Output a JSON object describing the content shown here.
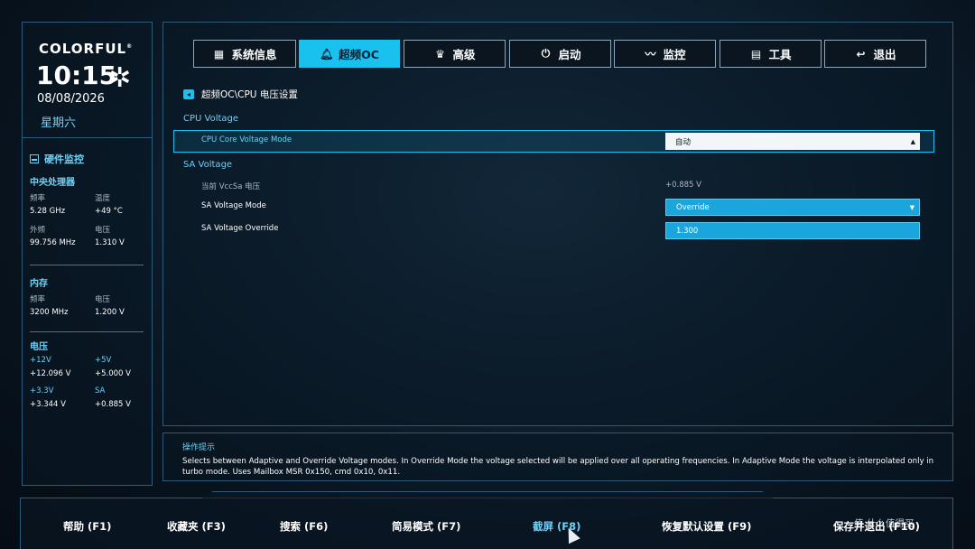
{
  "sidebar": {
    "brand": "COLORFUL",
    "brand_mark": "®",
    "time": "10:15",
    "date": "08/08/2026",
    "weekday": "星期六",
    "hw_title": "硬件监控",
    "cpu": {
      "title": "中央处理器",
      "freq_label": "频率",
      "freq_value": "5.28 GHz",
      "temp_label": "温度",
      "temp_value": "+49 °C",
      "bclk_label": "外频",
      "bclk_value": "99.756 MHz",
      "volt_label": "电压",
      "volt_value": "1.310 V"
    },
    "memory": {
      "title": "内存",
      "freq_label": "频率",
      "freq_value": "3200 MHz",
      "volt_label": "电压",
      "volt_value": "1.200 V"
    },
    "voltage": {
      "title": "电压",
      "v12_label": "+12V",
      "v12_value": "+12.096 V",
      "v5_label": "+5V",
      "v5_value": "+5.000 V",
      "v33_label": "+3.3V",
      "v33_value": "+3.344 V",
      "sa_label": "SA",
      "sa_value": "+0.885 V"
    }
  },
  "tabs": [
    {
      "label": "系统信息",
      "icon": "grid-icon"
    },
    {
      "label": "超频OC",
      "icon": "bell-icon",
      "active": true
    },
    {
      "label": "高级",
      "icon": "crown-icon"
    },
    {
      "label": "启动",
      "icon": "power-icon"
    },
    {
      "label": "监控",
      "icon": "pulse-icon"
    },
    {
      "label": "工具",
      "icon": "toolbox-icon"
    },
    {
      "label": "退出",
      "icon": "back-arrow-icon"
    }
  ],
  "breadcrumb": "超频OC\\CPU 电压设置",
  "groups": {
    "cpu_voltage": "CPU Voltage",
    "sa_voltage": "SA Voltage"
  },
  "settings": {
    "core_mode_label": "CPU Core Voltage Mode",
    "core_mode_value": "自动",
    "vccsa_label": "当前 VccSa 电压",
    "vccsa_value": "+0.885 V",
    "sa_mode_label": "SA Voltage Mode",
    "sa_mode_value": "Override",
    "sa_override_label": "SA Voltage Override",
    "sa_override_value": "1.300"
  },
  "help": {
    "title": "操作提示",
    "text": "Selects between Adaptive and Override Voltage modes. In Override Mode the voltage selected will be applied over all operating frequencies. In Adaptive Mode the voltage is interpolated only in turbo mode. Uses Mailbox MSR 0x150, cmd 0x10, 0x11."
  },
  "footer": {
    "help": "帮助 (F1)",
    "favorites": "收藏夹 (F3)",
    "search": "搜索 (F6)",
    "easy_mode": "简易模式 (F7)",
    "screenshot": "截屏 (F8)",
    "defaults": "恢复默认设置 (F9)",
    "save_exit": "保存并退出 (F10)"
  },
  "watermark": "值 什么值得买"
}
